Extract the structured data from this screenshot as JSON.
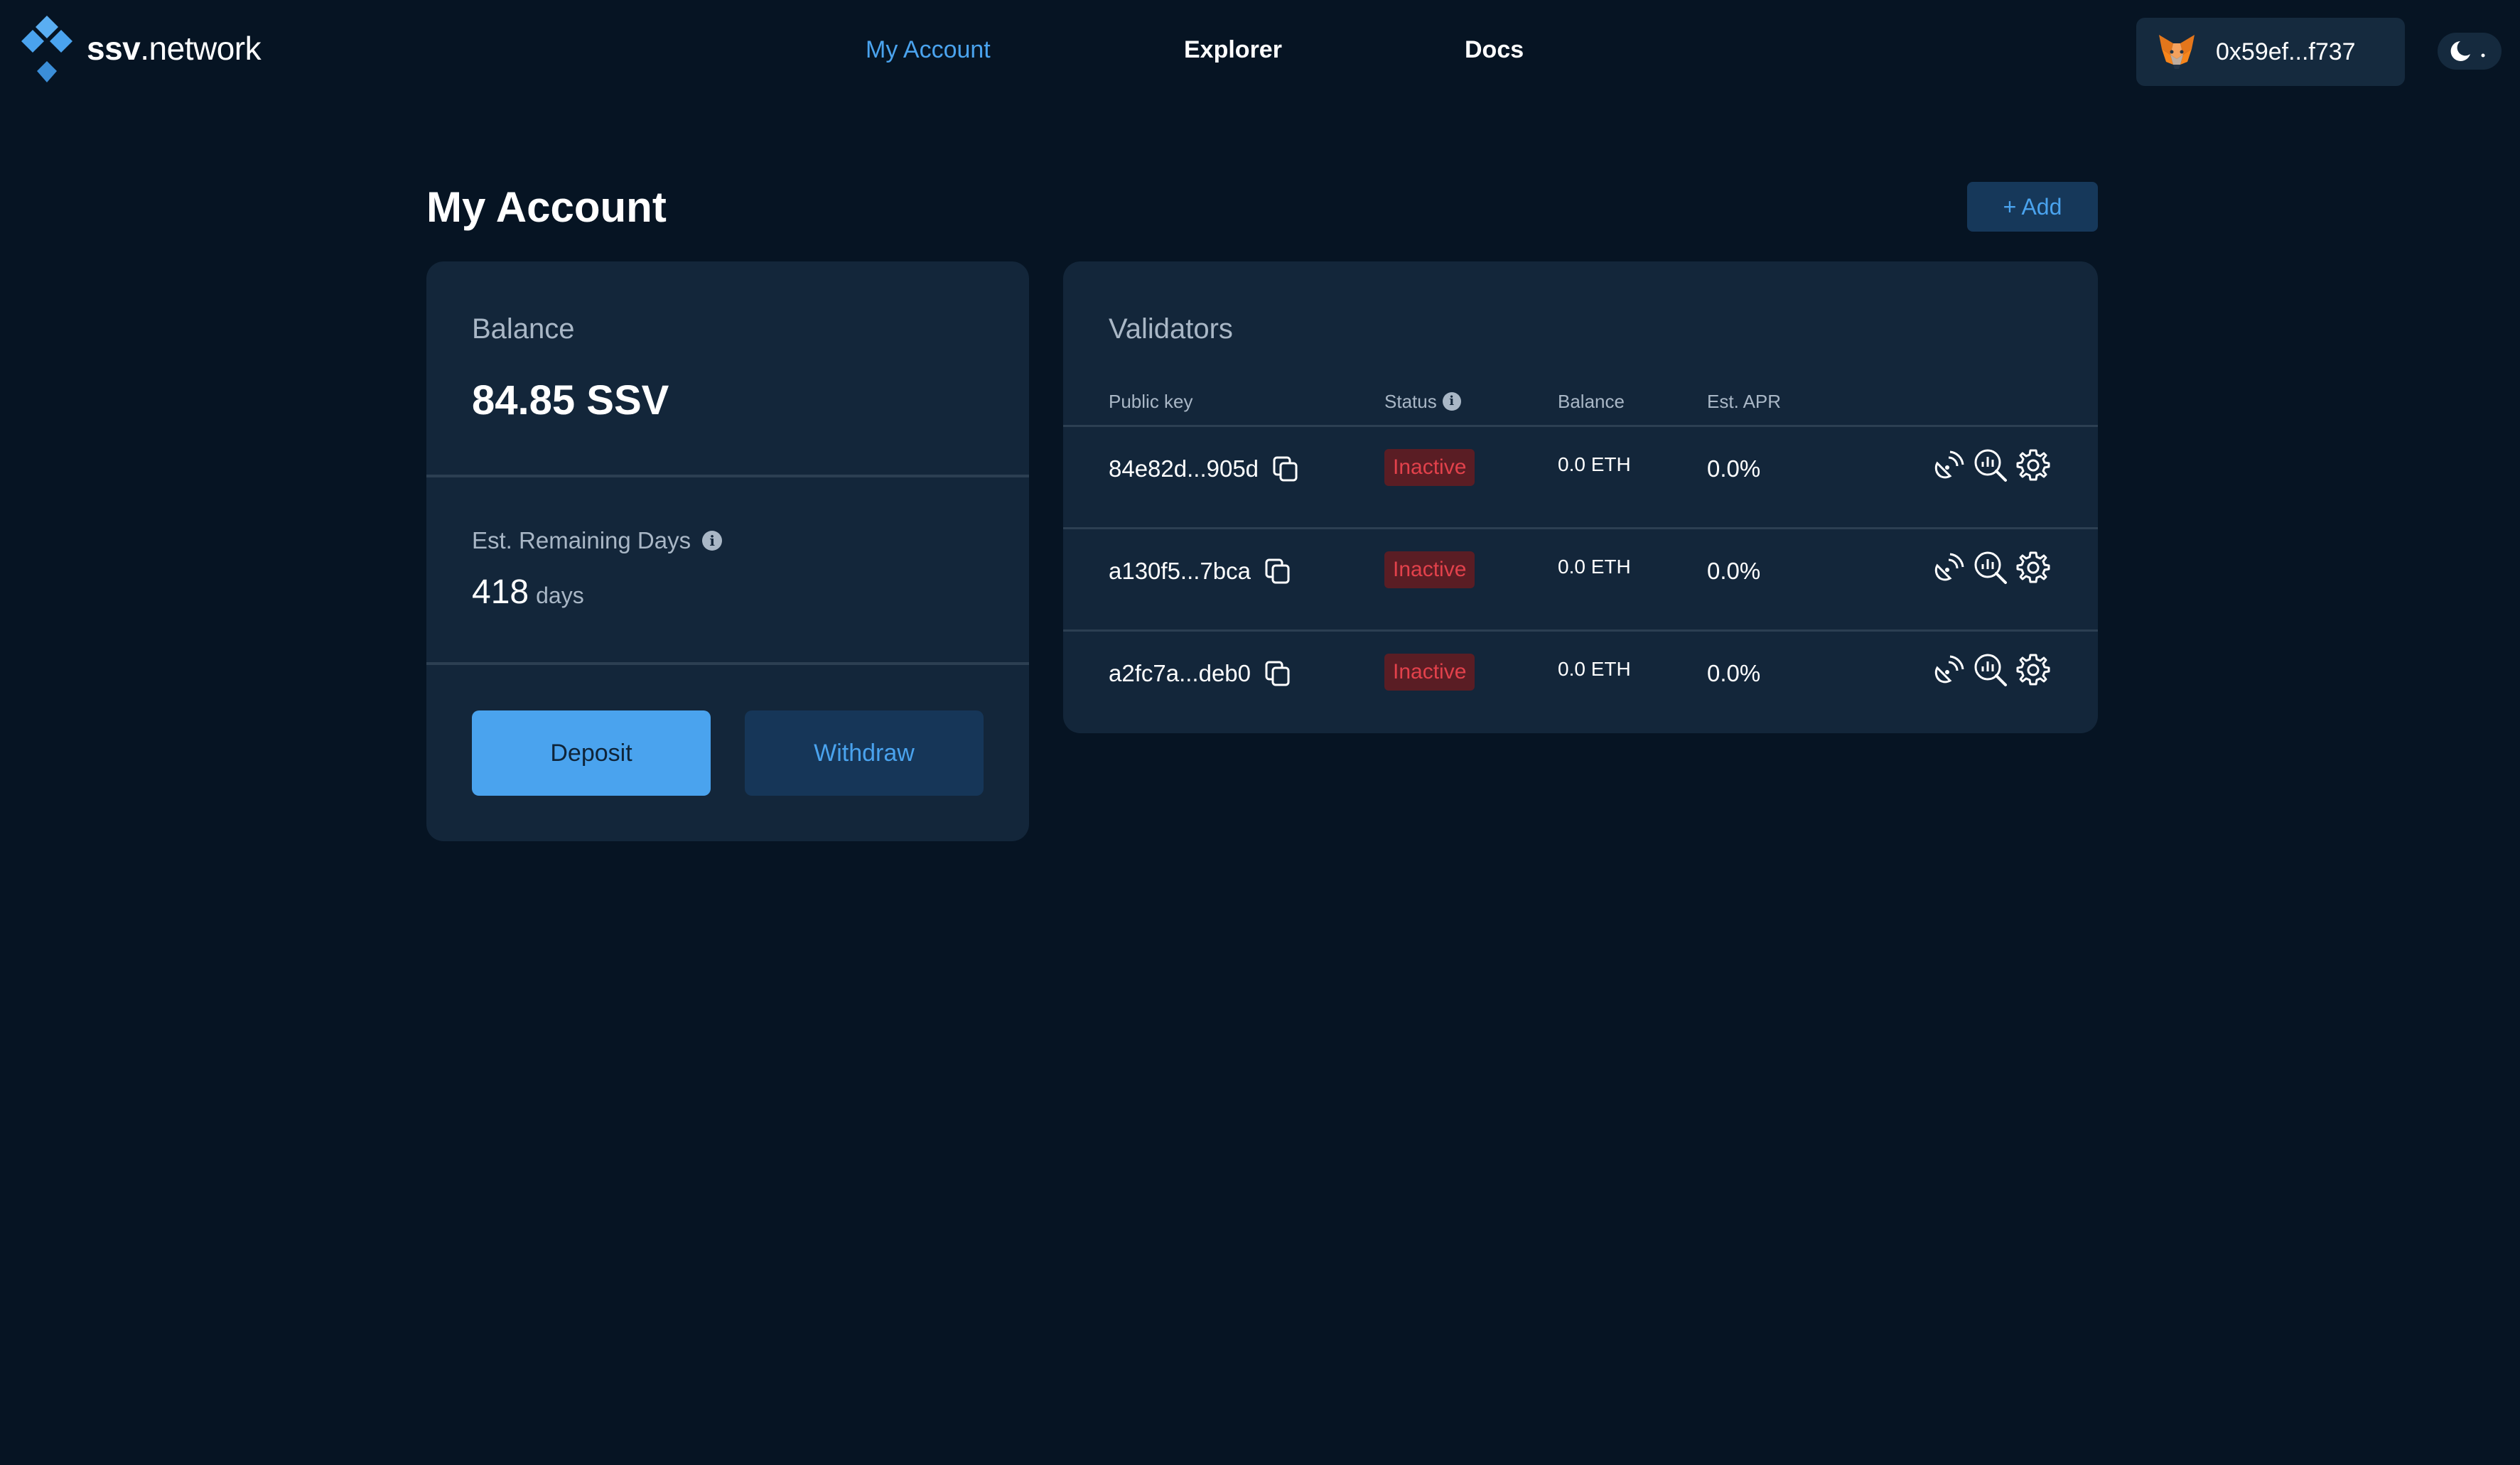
{
  "header": {
    "brand_bold": "ssv",
    "brand_rest": ".network",
    "nav": [
      {
        "label": "My Account",
        "active": true
      },
      {
        "label": "Explorer",
        "active": false
      },
      {
        "label": "Docs",
        "active": false
      }
    ],
    "wallet_address": "0x59ef...f737",
    "wallet_icon": "metamask-fox-icon",
    "theme_icon": "moon-icon"
  },
  "page": {
    "title": "My Account",
    "add_label": "+ Add"
  },
  "balance_card": {
    "title": "Balance",
    "value": "84.85 SSV",
    "est_label": "Est. Remaining Days",
    "est_days": "418",
    "est_unit": "days",
    "deposit_label": "Deposit",
    "withdraw_label": "Withdraw"
  },
  "validators": {
    "title": "Validators",
    "columns": {
      "public_key": "Public key",
      "status": "Status",
      "balance": "Balance",
      "apr": "Est. APR"
    },
    "rows": [
      {
        "public_key": "84e82d...905d",
        "status": "Inactive",
        "balance": "0.0 ETH",
        "apr": "0.0%"
      },
      {
        "public_key": "a130f5...7bca",
        "status": "Inactive",
        "balance": "0.0 ETH",
        "apr": "0.0%"
      },
      {
        "public_key": "a2fc7a...deb0",
        "status": "Inactive",
        "balance": "0.0 ETH",
        "apr": "0.0%"
      }
    ]
  },
  "colors": {
    "background": "#061423",
    "card": "#13263a",
    "accent": "#4aa3ee",
    "inactive_text": "#e2414b",
    "inactive_bg": "#5a1d24"
  }
}
